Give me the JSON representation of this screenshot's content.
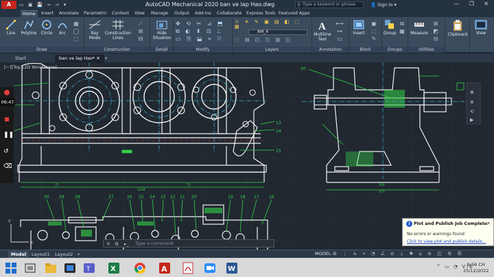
{
  "window": {
    "app_logo": "A",
    "title": "AutoCAD Mechanical 2020    ban ve lap Hao.dwg",
    "search_placeholder": "Type a keyword or phrase",
    "sign_in": "Sign In",
    "controls": "—  ❐  ✕"
  },
  "ribbon_tabs": [
    "Home",
    "Insert",
    "Annotate",
    "Parametric",
    "Content",
    "View",
    "Manage",
    "Output",
    "Add-ins",
    "Collaborate",
    "Express Tools",
    "Featured Apps"
  ],
  "active_tab": "Home",
  "ribbon": {
    "draw_tools": [
      "Line",
      "Polyline",
      "Circle",
      "Arc"
    ],
    "construction_tools": [
      "Ray",
      "Mode",
      "Construction",
      "Lines"
    ],
    "detail_tools": [
      "Hide",
      "Situation"
    ],
    "layer_current": "AM_4",
    "annotation_tool": [
      "Multiline",
      "Text"
    ],
    "block_tool": "Insert",
    "groups_tool": "Group",
    "utilities_tool": "Measure",
    "clipboard_tool": "Clipboard",
    "view_tool": "View",
    "panel_labels": [
      "Draw",
      "Construction",
      "Detail",
      "Modify",
      "Layers",
      "Annotation",
      "Block",
      "Groups",
      "Utilities"
    ]
  },
  "file_tabs": [
    "Start",
    "ban ve lap Hao*",
    "+"
  ],
  "active_file_tab": "ban ve lap Hao*",
  "viewport_label": "[−][Top][2D Wireframe]",
  "recording": {
    "time": "06:47"
  },
  "drawing": {
    "balloons_right": [
      "13",
      "14",
      "15"
    ],
    "balloon_top_right": "30",
    "bottom_balloons": [
      "30",
      "29",
      "28",
      "27",
      "26",
      "25",
      "24",
      "23",
      "22",
      "21",
      "20",
      "19",
      "18",
      "17",
      "16"
    ],
    "dims": [
      "1208",
      "209",
      "377"
    ]
  },
  "command_line": {
    "placeholder": "Type a command"
  },
  "layout_tabs": [
    "Model",
    "Layout1",
    "Layout2",
    "+"
  ],
  "active_layout": "Model",
  "status": {
    "model": "MODEL"
  },
  "notification": {
    "title": "Plot and Publish Job Complete",
    "message": "No errors or warnings found",
    "link": "Click to view plot and publish details..."
  },
  "taskbar": {
    "time": "9:56 CH",
    "date": "25/12/2022",
    "lang": "VIE"
  },
  "colors": {
    "title_bg": "#253241",
    "ribbon_bg": "#3b4b5e",
    "canvas_bg": "#212830",
    "line_white": "#f2f2f2",
    "line_green": "#34d34a",
    "line_cyan": "#38b6d8",
    "autocad_red": "#c4271c"
  }
}
